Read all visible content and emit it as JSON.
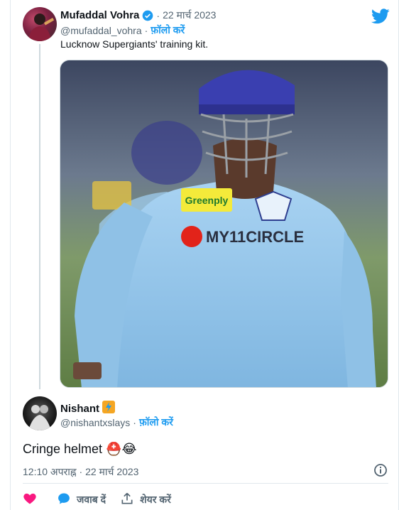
{
  "tweet": {
    "author_name": "Mufaddal Vohra",
    "separator": "·",
    "date": "22 मार्च 2023",
    "handle": "@mufaddal_vohra",
    "follow_label": "फ़ॉलो करें",
    "text": "Lucknow Supergiants' training kit.",
    "media_alt": "Cricketer in a light-blue training kit wearing a helmet",
    "kit_sponsor_1": "Greenply",
    "kit_sponsor_2": "MY11CIRCLE"
  },
  "reply": {
    "author_name": "Nishant",
    "handle": "@nishantxslays",
    "separator": "·",
    "follow_label": "फ़ॉलो करें",
    "text": "Cringe helmet",
    "emojis": "⛑️😂",
    "timestamp": "12:10 अपराह्न · 22 मार्च 2023"
  },
  "actions": {
    "like_label": "",
    "reply_label": "जवाब दें",
    "share_label": "शेयर करें"
  },
  "colors": {
    "accent": "#1d9bf0",
    "like": "#f91880",
    "muted": "#536471"
  },
  "icons": [
    "twitter-bird-icon",
    "verified-badge-icon",
    "info-icon",
    "heart-icon",
    "reply-bubble-icon",
    "share-icon"
  ]
}
